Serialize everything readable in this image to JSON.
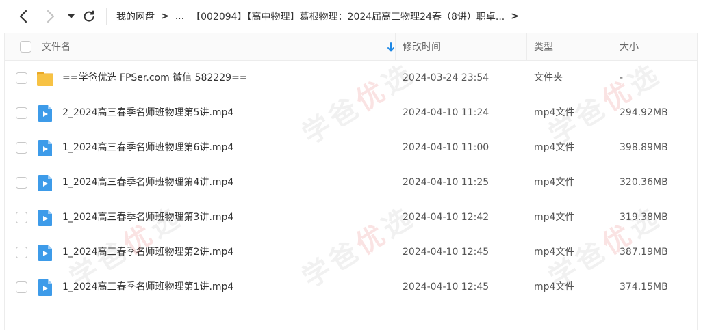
{
  "toolbar": {
    "breadcrumb": {
      "root": "我的网盘",
      "ellipsis": "...",
      "current": "【002094】【高中物理】葛根物理：2024届高三物理24春（8讲）职卓..."
    }
  },
  "header": {
    "name": "文件名",
    "time": "修改时间",
    "type": "类型",
    "size": "大小"
  },
  "watermark": {
    "a": "学爸",
    "b": "优",
    "c": "选"
  },
  "files": [
    {
      "name": "==学爸优选 FPSer.com 微信 582229==",
      "time": "2024-03-24 23:54",
      "type": "文件夹",
      "size": "-",
      "icon": "folder-icon"
    },
    {
      "name": "2_2024高三春季名师班物理第5讲.mp4",
      "time": "2024-04-10 11:24",
      "type": "mp4文件",
      "size": "294.92MB",
      "icon": "video-file-icon"
    },
    {
      "name": "1_2024高三春季名师班物理第6讲.mp4",
      "time": "2024-04-10 11:00",
      "type": "mp4文件",
      "size": "398.89MB",
      "icon": "video-file-icon"
    },
    {
      "name": "1_2024高三春季名师班物理第4讲.mp4",
      "time": "2024-04-10 11:25",
      "type": "mp4文件",
      "size": "320.36MB",
      "icon": "video-file-icon"
    },
    {
      "name": "1_2024高三春季名师班物理第3讲.mp4",
      "time": "2024-04-10 12:42",
      "type": "mp4文件",
      "size": "319.38MB",
      "icon": "video-file-icon"
    },
    {
      "name": "1_2024高三春季名师班物理第2讲.mp4",
      "time": "2024-04-10 12:45",
      "type": "mp4文件",
      "size": "387.19MB",
      "icon": "video-file-icon"
    },
    {
      "name": "1_2024高三春季名师班物理第1讲.mp4",
      "time": "2024-04-10 12:45",
      "type": "mp4文件",
      "size": "374.15MB",
      "icon": "video-file-icon"
    }
  ],
  "colors": {
    "accent": "#1e88e5",
    "folder": "#f7c244",
    "video": "#3d9be9"
  }
}
